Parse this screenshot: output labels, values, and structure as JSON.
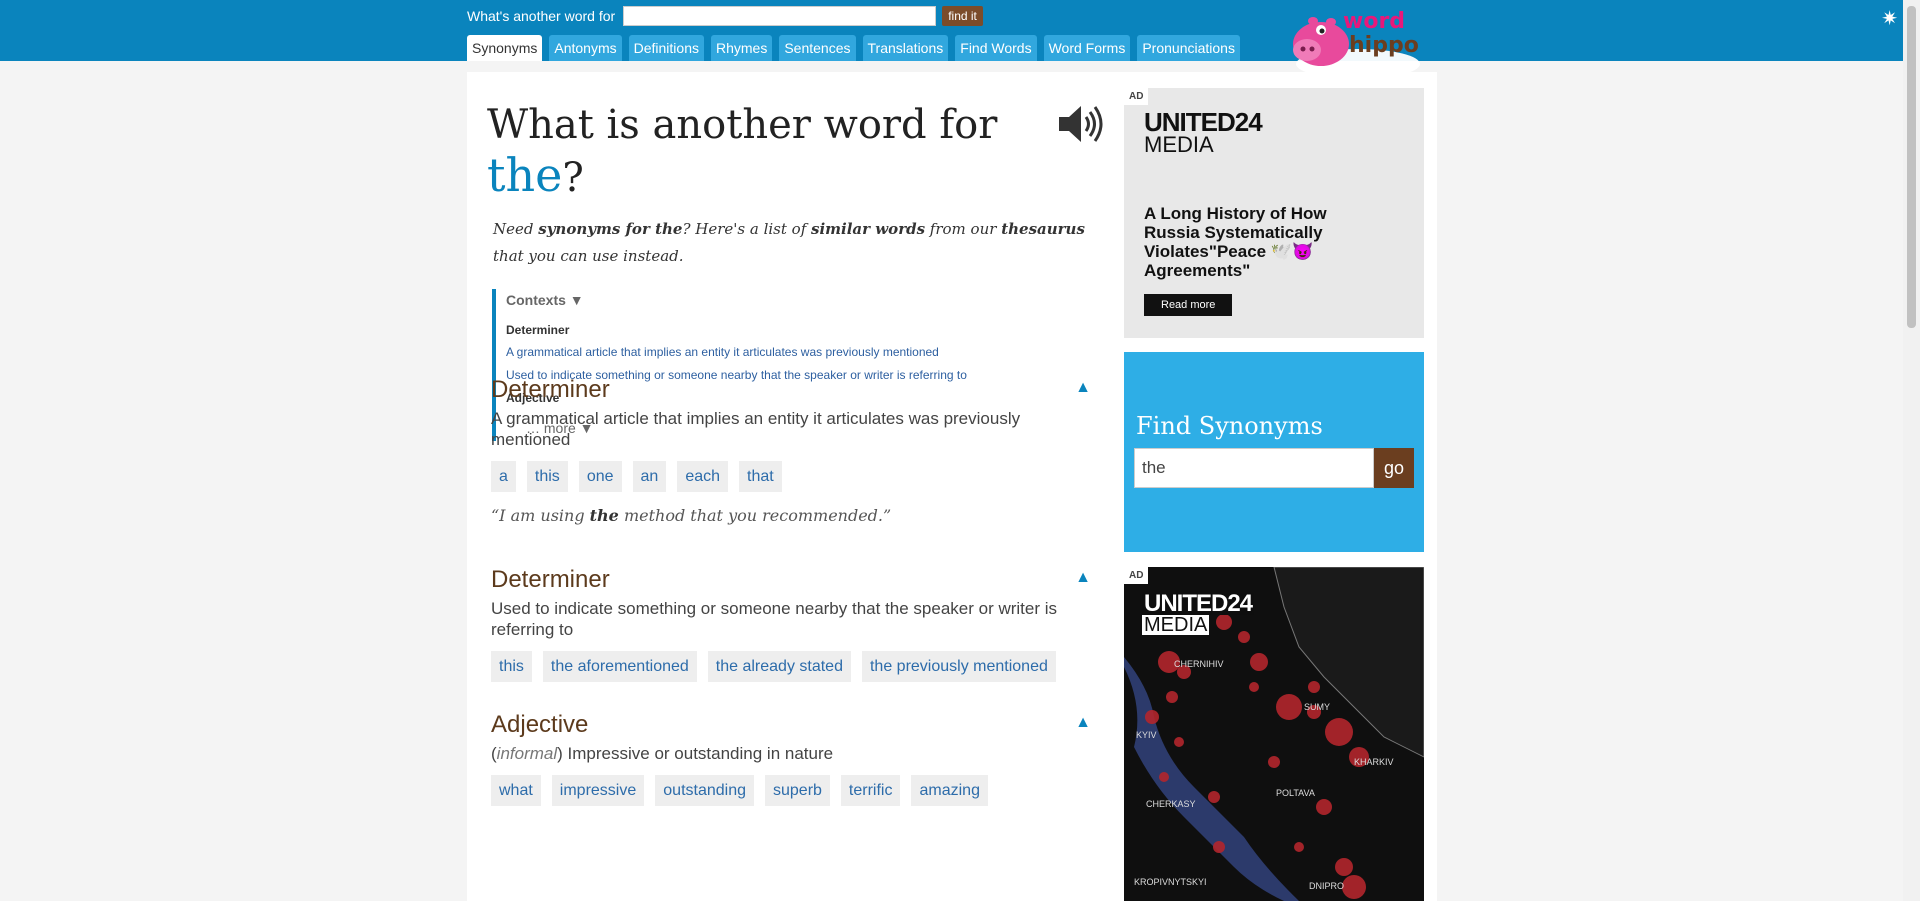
{
  "header": {
    "search_label": "What's another word for",
    "search_value": "",
    "find_button": "find it",
    "tabs": [
      "Synonyms",
      "Antonyms",
      "Definitions",
      "Rhymes",
      "Sentences",
      "Translations",
      "Find Words",
      "Word Forms",
      "Pronunciations"
    ],
    "active_tab": "Synonyms",
    "logo_word": "word",
    "logo_hippo": "hippo",
    "settings_icon": "gear-icon"
  },
  "page": {
    "title_prefix": "What is another word for",
    "word": "the",
    "title_suffix": "?",
    "speaker_icon": "speaker-icon",
    "intro": {
      "p1": "Need ",
      "b1": "synonyms for the",
      "p2": "? Here's a list of ",
      "b2": "similar words",
      "p3": " from our ",
      "b3": "thesaurus",
      "p4": " that you can use instead."
    },
    "contexts": {
      "label": "Contexts ▼",
      "items": [
        {
          "cat": "Determiner"
        },
        {
          "link": "A grammatical article that implies an entity it articulates was previously mentioned"
        },
        {
          "link": "Used to indicate something or someone nearby that the speaker or writer is referring to"
        },
        {
          "cat": "Adjective"
        }
      ],
      "more": "… more ▼"
    },
    "senses": [
      {
        "pos": "Determiner",
        "def": "A grammatical article that implies an entity it articulates was previously mentioned",
        "synonyms": [
          "a",
          "this",
          "one",
          "an",
          "each",
          "that"
        ],
        "example_pre": "“I am using ",
        "example_word": "the",
        "example_post": " method that you recommended.”",
        "collapse": "▲"
      },
      {
        "pos": "Determiner",
        "def": "Used to indicate something or someone nearby that the speaker or writer is referring to",
        "synonyms": [
          "this",
          "the aforementioned",
          "the already stated",
          "the previously mentioned"
        ],
        "collapse": "▲"
      },
      {
        "pos": "Adjective",
        "def_tag": "informal",
        "def": " Impressive or outstanding in nature",
        "synonyms": [
          "what",
          "impressive",
          "outstanding",
          "superb",
          "terrific",
          "amazing"
        ],
        "collapse": "▲"
      }
    ]
  },
  "sidebar": {
    "ad1": {
      "badge": "AD",
      "brand": "UNITED24",
      "brand2": "MEDIA",
      "headline": "A Long History of How Russia Systematically Violates\"Peace 🕊️😈 Agreements\"",
      "button": "Read more"
    },
    "find_synonyms": {
      "title": "Find Synonyms",
      "input_value": "the",
      "button": "go"
    },
    "ad2": {
      "badge": "AD",
      "brand": "UNITED24",
      "brand2": "MEDIA",
      "cities": [
        "CHERNIHIV",
        "SUMY",
        "KYIV",
        "KHARKIV",
        "POLTAVA",
        "CHERKASY",
        "KROPIVNYTSKYI",
        "DNIPRO"
      ]
    }
  }
}
